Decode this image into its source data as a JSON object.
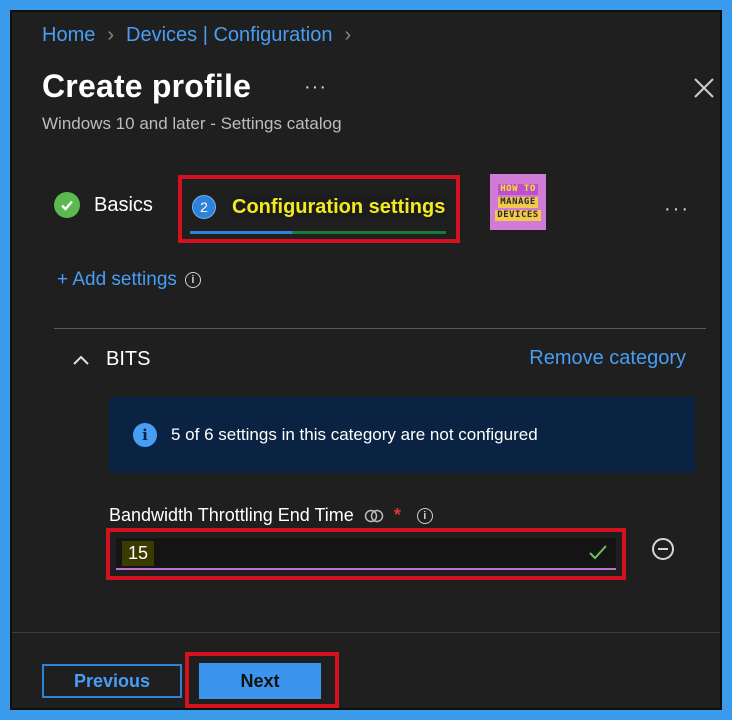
{
  "breadcrumb": {
    "items": [
      "Home",
      "Devices | Configuration"
    ]
  },
  "header": {
    "title": "Create profile",
    "more": "···",
    "subtitle": "Windows 10 and later - Settings catalog"
  },
  "tabs": [
    {
      "label": "Basics",
      "state": "completed"
    },
    {
      "number": "2",
      "label": "Configuration settings",
      "state": "current"
    }
  ],
  "logo": {
    "line1": "HOW TO",
    "line2": "MANAGE",
    "line3": "DEVICES"
  },
  "tabs_more": "···",
  "add_settings": {
    "label": "+ Add settings",
    "info": "i"
  },
  "category": {
    "name": "BITS",
    "remove_label": "Remove category"
  },
  "banner": {
    "icon": "i",
    "text": "5 of 6 settings in this category are not configured"
  },
  "setting": {
    "label": "Bandwidth Throttling End Time",
    "required_mark": "*",
    "info": "i",
    "value": "15"
  },
  "footer": {
    "previous_label": "Previous",
    "next_label": "Next"
  },
  "colors": {
    "accent": "#479ef5",
    "highlight_border": "#d4121f",
    "success": "#5bb94f",
    "highlight_text": "#f2ea1e"
  }
}
